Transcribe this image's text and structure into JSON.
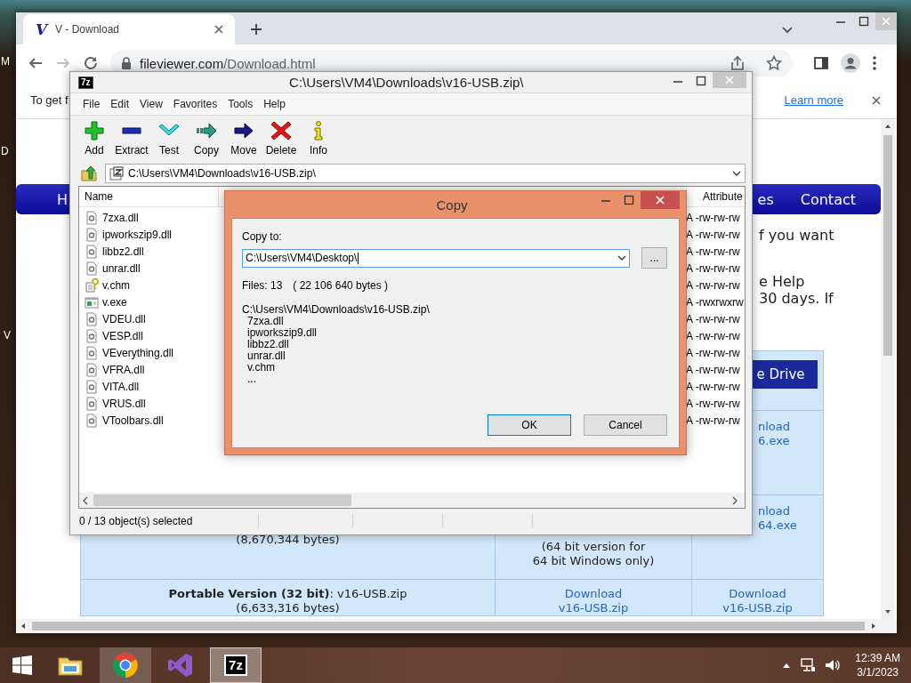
{
  "desktop": {
    "icon_labels": [
      "M",
      "D",
      "V"
    ]
  },
  "browser": {
    "tab": {
      "favicon_text": "V",
      "title": "V - Download",
      "selected": true
    },
    "navigation": {
      "can_go_forward": false
    },
    "address": {
      "host": "fileviewer.com",
      "path": "/Download.html"
    },
    "info_bar": {
      "text": "To get f",
      "link": "Learn more"
    },
    "nav_items": [
      {
        "label": "H"
      },
      {
        "label": "es"
      },
      {
        "label": "Contact"
      }
    ],
    "intro_lines": [
      "f you want",
      "e Help",
      "30 days. If"
    ],
    "drive_button": "e Drive",
    "download_rows": [
      {
        "column_3": {
          "kind": "link",
          "lines": [
            "nload",
            "6.exe"
          ]
        }
      },
      {
        "column_1": {
          "kind": "text",
          "lines": [
            "(8,670,344 bytes)"
          ]
        },
        "column_2": {
          "kind": "text",
          "lines": [
            "(64 bit version for",
            "64 bit Windows only)"
          ]
        },
        "column_3": {
          "kind": "link",
          "lines": [
            "nload",
            "64.exe"
          ]
        }
      },
      {
        "column_1": {
          "kind": "text",
          "lines": [
            "**Portable Version (32 bit)**: v16-USB.zip",
            "(6,633,316 bytes)"
          ]
        },
        "column_2": {
          "kind": "link",
          "lines": [
            "Download",
            "v16-USB.zip"
          ]
        },
        "column_3": {
          "kind": "link",
          "lines": [
            "Download",
            "v16-USB.zip"
          ]
        }
      }
    ]
  },
  "archive_window": {
    "logo_text": "7z",
    "title": "C:\\Users\\VM4\\Downloads\\v16-USB.zip\\",
    "menu": [
      "File",
      "Edit",
      "View",
      "Favorites",
      "Tools",
      "Help"
    ],
    "toolbar": [
      {
        "kind": "add",
        "label": "Add"
      },
      {
        "kind": "extract",
        "label": "Extract"
      },
      {
        "kind": "test",
        "label": "Test"
      },
      {
        "kind": "copy",
        "label": "Copy"
      },
      {
        "kind": "move",
        "label": "Move"
      },
      {
        "kind": "delete",
        "label": "Delete"
      },
      {
        "kind": "info",
        "label": "Info"
      }
    ],
    "path": "C:\\Users\\VM4\\Downloads\\v16-USB.zip\\",
    "columns": [
      "Name",
      "Attribute"
    ],
    "files": [
      {
        "name": "7zxa.dll",
        "kind": "dll",
        "attributes": "A -rw-rw-rw"
      },
      {
        "name": "ipworkszip9.dll",
        "kind": "dll",
        "attributes": "A -rw-rw-rw"
      },
      {
        "name": "libbz2.dll",
        "kind": "dll",
        "attributes": "A -rw-rw-rw"
      },
      {
        "name": "unrar.dll",
        "kind": "dll",
        "attributes": "A -rw-rw-rw"
      },
      {
        "name": "v.chm",
        "kind": "chm",
        "attributes": "A -rw-rw-rw"
      },
      {
        "name": "v.exe",
        "kind": "exe",
        "attributes": "A -rwxrwxrw"
      },
      {
        "name": "VDEU.dll",
        "kind": "dll",
        "attributes": "A -rw-rw-rw"
      },
      {
        "name": "VESP.dll",
        "kind": "dll",
        "attributes": "A -rw-rw-rw"
      },
      {
        "name": "VEverything.dll",
        "kind": "dll",
        "attributes": "A -rw-rw-rw"
      },
      {
        "name": "VFRA.dll",
        "kind": "dll",
        "attributes": "A -rw-rw-rw"
      },
      {
        "name": "VITA.dll",
        "kind": "dll",
        "attributes": "A -rw-rw-rw"
      },
      {
        "name": "VRUS.dll",
        "kind": "dll",
        "attributes": "A -rw-rw-rw"
      },
      {
        "name": "VToolbars.dll",
        "kind": "dll",
        "attributes": "A -rw-rw-rw"
      }
    ],
    "status": "0 / 13 object(s) selected"
  },
  "copy_dialog": {
    "title": "Copy",
    "label": "Copy to:",
    "destination": {
      "value": "C:\\Users\\VM4\\Desktop\\",
      "focused": true
    },
    "browse": "...",
    "file_count": "Files: 13",
    "total_size": "( 22 106 640 bytes )",
    "source": "C:\\Users\\VM4\\Downloads\\v16-USB.zip\\",
    "items": [
      "7zxa.dll",
      "ipworkszip9.dll",
      "libbz2.dll",
      "unrar.dll",
      "v.chm",
      "..."
    ],
    "buttons": [
      {
        "label": "OK",
        "default": true
      },
      {
        "label": "Cancel",
        "default": false
      }
    ]
  },
  "taskbar": {
    "apps": [
      {
        "kind": "explorer",
        "open": false,
        "selected": false
      },
      {
        "kind": "chrome",
        "open": true,
        "selected": false
      },
      {
        "kind": "visual-studio",
        "open": false,
        "selected": false
      },
      {
        "kind": "sevenzip",
        "open": true,
        "selected": true,
        "badge_text": "7z"
      }
    ],
    "clock": {
      "time": "12:39 AM",
      "date": "3/1/2023"
    }
  }
}
